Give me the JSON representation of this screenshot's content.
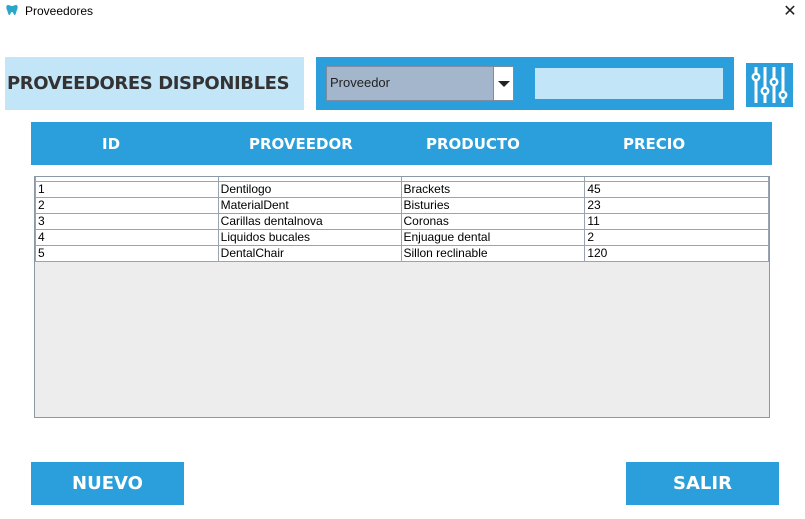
{
  "window": {
    "title": "Proveedores",
    "close_glyph": "✕",
    "icon": "tooth-icon"
  },
  "header": {
    "title": "PROVEEDORES DISPONIBLES"
  },
  "filter": {
    "selected_option": "Proveedor",
    "search_value": "",
    "settings_icon": "sliders-icon"
  },
  "table": {
    "columns": [
      "ID",
      "PROVEEDOR",
      "PRODUCTO",
      "PRECIO"
    ],
    "rows": [
      {
        "id": "1",
        "proveedor": "Dentilogo",
        "producto": "Brackets",
        "precio": "45"
      },
      {
        "id": "2",
        "proveedor": "MaterialDent",
        "producto": "Bisturies",
        "precio": "23"
      },
      {
        "id": "3",
        "proveedor": "Carillas dentalnova",
        "producto": "Coronas",
        "precio": "11"
      },
      {
        "id": "4",
        "proveedor": "Liquidos bucales",
        "producto": "Enjuague dental",
        "precio": "2"
      },
      {
        "id": "5",
        "proveedor": "DentalChair",
        "producto": "Sillon reclinable",
        "precio": "120"
      }
    ]
  },
  "buttons": {
    "nuevo": "NUEVO",
    "salir": "SALIR"
  },
  "colors": {
    "accent": "#2a9fdb",
    "light_accent": "#c3e5f8",
    "select_bg": "#a4b6cc"
  }
}
